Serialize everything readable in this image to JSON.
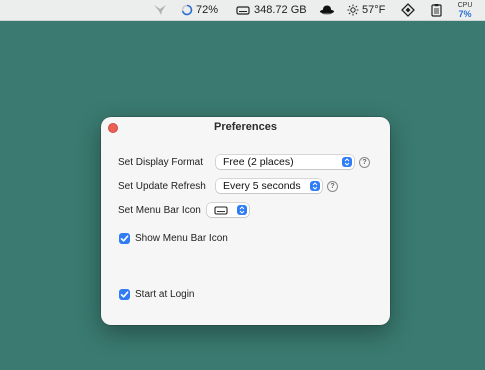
{
  "menubar": {
    "items": [
      {
        "icon": "bird-icon",
        "label": ""
      },
      {
        "icon": "battery-ring-icon",
        "label": "72%"
      },
      {
        "icon": "disk-icon",
        "label": "348.72 GB"
      },
      {
        "icon": "ufo-icon",
        "label": ""
      },
      {
        "icon": "sun-icon",
        "label": "57°F"
      },
      {
        "icon": "diamond-icon",
        "label": ""
      },
      {
        "icon": "clipboard-icon",
        "label": ""
      }
    ],
    "cpu": {
      "label": "CPU",
      "value": "7%"
    }
  },
  "window": {
    "title": "Preferences",
    "display_format": {
      "label": "Set Display Format",
      "value": "Free (2 places)"
    },
    "update_refresh": {
      "label": "Set Update Refresh",
      "value": "Every 5 seconds"
    },
    "menu_bar_icon": {
      "label": "Set Menu Bar Icon",
      "value_icon": "disk-icon"
    },
    "show_menu_bar_icon": {
      "label": "Show Menu Bar Icon",
      "checked": true
    },
    "start_at_login": {
      "label": "Start at Login",
      "checked": true
    },
    "help_glyph": "?",
    "accent_color": "#2f7cf6"
  }
}
